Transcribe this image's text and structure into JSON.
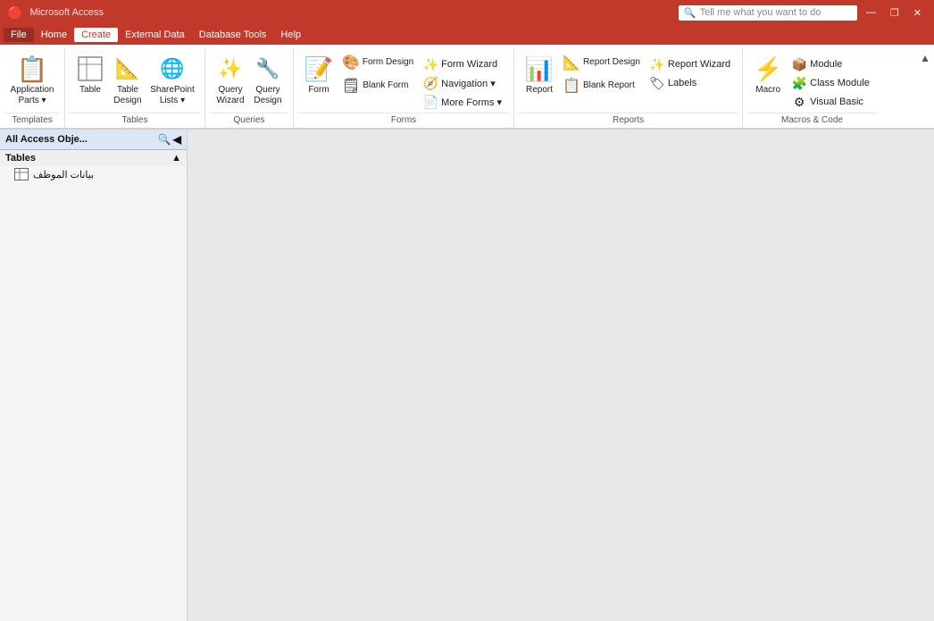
{
  "titlebar": {
    "search_placeholder": "Tell me what you want to do",
    "search_icon": "🔍"
  },
  "menubar": {
    "items": [
      {
        "label": "File",
        "active": false
      },
      {
        "label": "Home",
        "active": false
      },
      {
        "label": "Create",
        "active": true
      },
      {
        "label": "External Data",
        "active": false
      },
      {
        "label": "Database Tools",
        "active": false
      },
      {
        "label": "Help",
        "active": false
      }
    ]
  },
  "ribbon": {
    "groups": [
      {
        "id": "templates",
        "label": "Templates",
        "buttons": [
          {
            "id": "application-parts",
            "icon": "📋",
            "label": "Application\nParts",
            "has_dropdown": true,
            "large": true
          }
        ]
      },
      {
        "id": "tables",
        "label": "Tables",
        "buttons": [
          {
            "id": "table",
            "icon": "⊞",
            "label": "Table",
            "large": true
          },
          {
            "id": "table-design",
            "icon": "📐",
            "label": "Table\nDesign",
            "large": false
          },
          {
            "id": "sharepoint-lists",
            "icon": "🌐",
            "label": "SharePoint\nLists",
            "has_dropdown": true,
            "large": false
          }
        ]
      },
      {
        "id": "queries",
        "label": "Queries",
        "buttons": [
          {
            "id": "query-wizard",
            "icon": "✨",
            "label": "Query\nWizard",
            "large": true
          },
          {
            "id": "query-design",
            "icon": "🔧",
            "label": "Query\nDesign",
            "large": true
          }
        ]
      },
      {
        "id": "forms",
        "label": "Forms",
        "small_buttons": [
          {
            "id": "form-wizard",
            "icon": "✨",
            "label": "Form Wizard"
          },
          {
            "id": "navigation",
            "icon": "🧭",
            "label": "Navigation ▾"
          },
          {
            "id": "more-forms",
            "icon": "📄",
            "label": "More Forms ▾"
          }
        ],
        "large_buttons": [
          {
            "id": "form",
            "icon": "📝",
            "label": "Form",
            "large": true
          },
          {
            "id": "form-design",
            "icon": "🎨",
            "label": "Form\nDesign",
            "large": false
          },
          {
            "id": "blank-form",
            "icon": "🗒",
            "label": "Blank\nForm",
            "large": false
          }
        ]
      },
      {
        "id": "reports",
        "label": "Reports",
        "small_buttons": [
          {
            "id": "report-wizard",
            "icon": "✨",
            "label": "Report Wizard"
          },
          {
            "id": "labels",
            "icon": "🏷",
            "label": "Labels"
          }
        ],
        "large_buttons": [
          {
            "id": "report",
            "icon": "📊",
            "label": "Report",
            "large": true
          },
          {
            "id": "report-design",
            "icon": "📐",
            "label": "Report\nDesign",
            "large": false
          },
          {
            "id": "blank-report",
            "icon": "📋",
            "label": "Blank\nReport",
            "large": false
          }
        ]
      },
      {
        "id": "macros-code",
        "label": "Macros & Code",
        "small_buttons": [
          {
            "id": "module",
            "icon": "📦",
            "label": "Module"
          },
          {
            "id": "class-module",
            "icon": "🧩",
            "label": "Class Module"
          },
          {
            "id": "visual-basic",
            "icon": "⚙",
            "label": "Visual Basic"
          }
        ],
        "large_buttons": [
          {
            "id": "macro",
            "icon": "⚡",
            "label": "Macro",
            "large": true
          }
        ]
      }
    ],
    "collapse_icon": "▲"
  },
  "sidebar": {
    "title": "All Access Obje...",
    "search_icon": "🔍",
    "pin_icon": "📌",
    "collapse_icon": "◀",
    "sections": [
      {
        "id": "tables",
        "label": "Tables",
        "collapse_icon": "▲",
        "items": [
          {
            "id": "employee-data",
            "label": "بيانات الموظف",
            "icon": "table"
          }
        ]
      }
    ]
  },
  "content": {
    "background": "#e8e8e8"
  }
}
